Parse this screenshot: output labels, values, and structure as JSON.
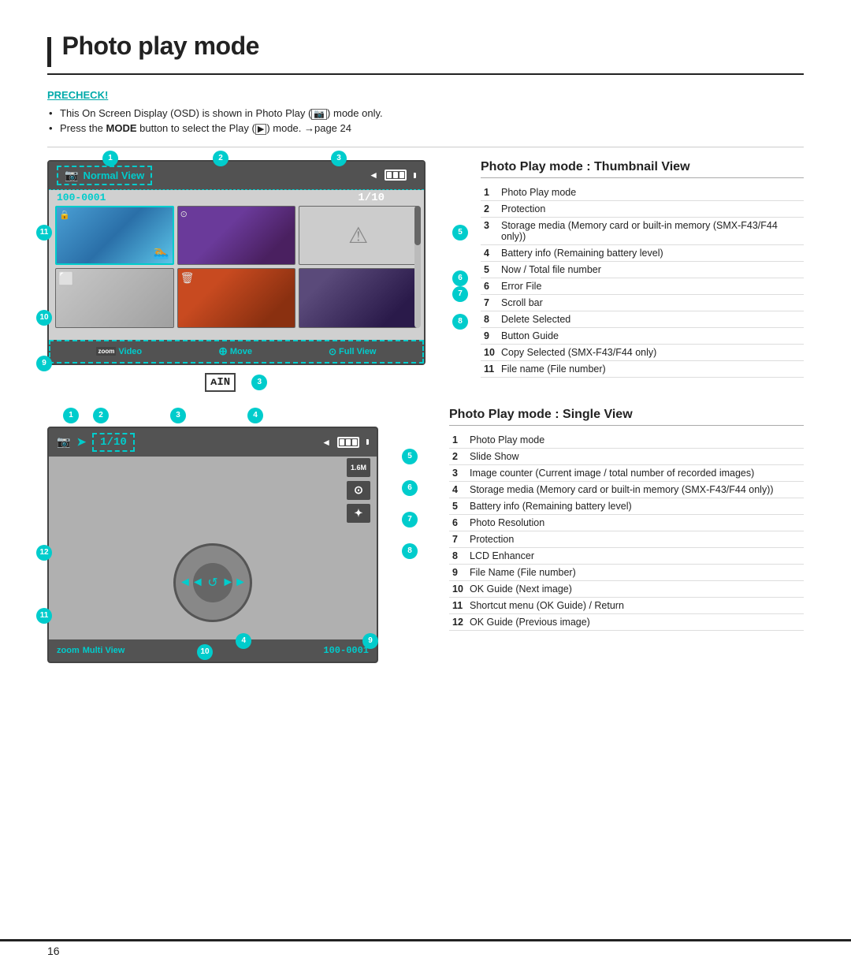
{
  "page": {
    "title": "Photo play mode",
    "number": "16"
  },
  "precheck": {
    "label": "PRECHECK!",
    "bullets": [
      "This On Screen Display (OSD) is shown in Photo Play (   ) mode only.",
      "Press the MODE button to select the Play (   ) mode. →page 24"
    ]
  },
  "thumbnail_view": {
    "title": "Photo Play mode : Thumbnail View",
    "screen": {
      "mode_label": "Normal View",
      "filename": "100-0001",
      "counter": "1/10",
      "bottom_items": [
        "Video",
        "Move",
        "Full View"
      ]
    },
    "items": [
      {
        "num": "1",
        "label": "Photo Play mode"
      },
      {
        "num": "2",
        "label": "Protection"
      },
      {
        "num": "3",
        "label": "Storage media (Memory card or built-in memory (SMX-F43/F44 only))"
      },
      {
        "num": "4",
        "label": "Battery info (Remaining battery level)"
      },
      {
        "num": "5",
        "label": "Now / Total file number"
      },
      {
        "num": "6",
        "label": "Error File"
      },
      {
        "num": "7",
        "label": "Scroll bar"
      },
      {
        "num": "8",
        "label": "Delete Selected"
      },
      {
        "num": "9",
        "label": "Button Guide"
      },
      {
        "num": "10",
        "label": "Copy Selected (SMX-F43/F44 only)"
      },
      {
        "num": "11",
        "label": "File name (File number)"
      }
    ]
  },
  "single_view": {
    "title": "Photo Play mode : Single View",
    "screen": {
      "counter": "1/10",
      "filename": "100-0001",
      "bottom_left": "Multi View"
    },
    "items": [
      {
        "num": "1",
        "label": "Photo Play mode"
      },
      {
        "num": "2",
        "label": "Slide Show"
      },
      {
        "num": "3",
        "label": "Image counter (Current image / total number of recorded images)"
      },
      {
        "num": "4",
        "label": "Storage media (Memory card or built-in memory (SMX-F43/F44 only))"
      },
      {
        "num": "5",
        "label": "Battery info (Remaining battery level)"
      },
      {
        "num": "6",
        "label": "Photo Resolution"
      },
      {
        "num": "7",
        "label": "Protection"
      },
      {
        "num": "8",
        "label": "LCD Enhancer"
      },
      {
        "num": "9",
        "label": "File Name (File number)"
      },
      {
        "num": "10",
        "label": "OK Guide (Next image)"
      },
      {
        "num": "11",
        "label": "Shortcut menu (OK Guide) / Return"
      },
      {
        "num": "12",
        "label": "OK Guide (Previous image)"
      }
    ]
  },
  "icons": {
    "camera_icon": "📷",
    "lock_icon": "🔒",
    "delete_icon": "🗑",
    "warning_icon": "⚠",
    "refresh_icon": "↺",
    "left_arrow": "◄",
    "right_arrow": "►",
    "up_arrow": "▲",
    "down_arrow": "▼",
    "prev_icon": "◄◄",
    "next_icon": "►►"
  },
  "colors": {
    "cyan": "#00aaaa",
    "dark": "#222222",
    "battery_full": "#ffffff"
  }
}
